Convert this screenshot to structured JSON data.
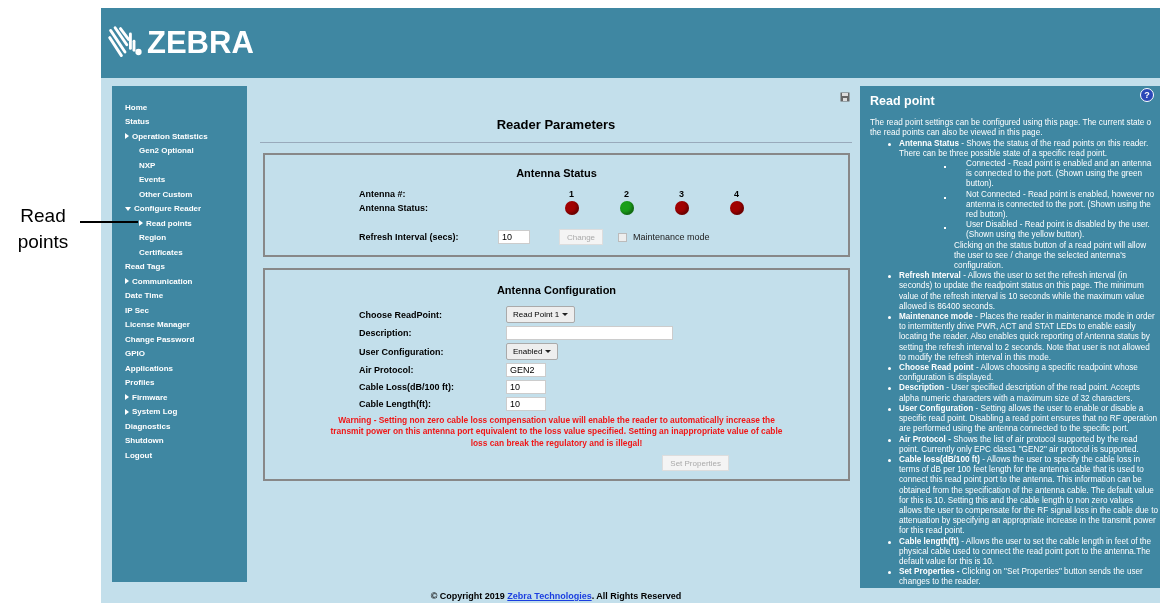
{
  "callout": {
    "text": "Read points"
  },
  "header": {
    "logo_text": "ZEBRA"
  },
  "sidebar": {
    "items": [
      {
        "label": "Home",
        "kind": "leaf"
      },
      {
        "label": "Status",
        "kind": "leaf"
      },
      {
        "label": "Operation Statistics",
        "kind": "collapsed",
        "children": [
          {
            "label": "Gen2 Optional",
            "kind": "leaf"
          },
          {
            "label": "NXP",
            "kind": "leaf"
          },
          {
            "label": "Events",
            "kind": "leaf"
          },
          {
            "label": "Other Custom",
            "kind": "leaf"
          }
        ]
      },
      {
        "label": "Configure Reader",
        "kind": "expanded",
        "children": [
          {
            "label": "Read points",
            "kind": "collapsed"
          },
          {
            "label": "Region",
            "kind": "leaf"
          },
          {
            "label": "Certificates",
            "kind": "leaf"
          }
        ]
      },
      {
        "label": "Read Tags",
        "kind": "leaf"
      },
      {
        "label": "Communication",
        "kind": "collapsed"
      },
      {
        "label": "Date Time",
        "kind": "leaf"
      },
      {
        "label": "IP Sec",
        "kind": "leaf"
      },
      {
        "label": "License Manager",
        "kind": "leaf"
      },
      {
        "label": "Change Password",
        "kind": "leaf"
      },
      {
        "label": "GPIO",
        "kind": "leaf"
      },
      {
        "label": "Applications",
        "kind": "leaf"
      },
      {
        "label": "Profiles",
        "kind": "leaf"
      },
      {
        "label": "Firmware",
        "kind": "collapsed"
      },
      {
        "label": "System Log",
        "kind": "collapsed"
      },
      {
        "label": "Diagnostics",
        "kind": "leaf"
      },
      {
        "label": "Shutdown",
        "kind": "leaf"
      },
      {
        "label": "Logout",
        "kind": "leaf"
      }
    ]
  },
  "main": {
    "title": "Reader Parameters",
    "antenna_status": {
      "title": "Antenna Status",
      "number_label": "Antenna #:",
      "status_label": "Antenna Status:",
      "antennas": [
        {
          "number": "1",
          "color": "#a10000"
        },
        {
          "number": "2",
          "color": "#1a9e1a"
        },
        {
          "number": "3",
          "color": "#a10000"
        },
        {
          "number": "4",
          "color": "#a10000"
        }
      ],
      "refresh_label": "Refresh Interval (secs):",
      "refresh_value": "10",
      "change_button": {
        "label": "Change",
        "disabled": true
      },
      "maintenance": {
        "label": "Maintenance mode",
        "checked": false
      }
    },
    "antenna_config": {
      "title": "Antenna Configuration",
      "fields": [
        {
          "kind": "dropdown",
          "label": "Choose ReadPoint:",
          "value": "Read Point 1"
        },
        {
          "kind": "wide_text",
          "label": "Description:"
        },
        {
          "kind": "dropdown",
          "label": "User Configuration:",
          "value": "Enabled"
        },
        {
          "kind": "text",
          "label": "Air Protocol:",
          "value": "GEN2"
        },
        {
          "kind": "text",
          "label": "Cable Loss(dB/100 ft):",
          "value": "10"
        },
        {
          "kind": "text",
          "label": "Cable Length(ft):",
          "value": "10"
        }
      ],
      "warning": "Warning - Setting non zero cable loss compensation value will enable the reader to automatically increase the transmit power on this antenna port equivalent to the loss value specified. Setting an inappropriate value of cable loss can break the regulatory and is illegal!",
      "set_button": {
        "label": "Set Properties",
        "disabled": true
      }
    }
  },
  "help": {
    "title": "Read point",
    "help_icon": "?",
    "intro": "The read point settings can be configured using this page. The current state o the read points can also be viewed in this page.",
    "items": [
      {
        "text": "**Antenna Status** - Shows the status of the read points on this reader. There can be three possible state of a specific read point.",
        "subitems": [
          "Connected - Read point is enabled and an antenna is connected to the port. (Shown using the green button).",
          "Not Connected - Read point is enabled, however no antenna is connected to the port. (Shown using the red button).",
          "User Disabled - Read point is disabled by the user. (Shown using the yellow button)."
        ],
        "note": "Clicking on the status button of a read point will allow the user to see / change the selected antenna's configuration."
      },
      {
        "text": "**Refresh Interval** - Allows the user to set the refresh interval (in seconds) to update the readpoint status on this page. The minimum value of the refresh interval is 10 seconds while the maximum value allowed is 86400 seconds."
      },
      {
        "text": "**Maintenance mode** - Places the reader in maintenance mode in order to intermittently drive PWR, ACT and STAT LEDs to enable easily locating the reader. Also enables quick reporting of Antenna status by setting the refresh interval to 2 seconds. Note that user is not allowed to modify the refresh interval in this mode."
      },
      {
        "text": "**Choose Read point** - Allows choosing a specific readpoint whose configuration is displayed."
      },
      {
        "text": "**Description** - User specified description of the read point. Accepts alpha numeric characters with a maximum size of 32 characters."
      },
      {
        "text": "**User Configuration** - Setting allows the user to enable or disable a specific read point. Disabling a read point ensures that no RF operation are performed using the antenna connected to the specific port."
      },
      {
        "text": "**Air Protocol -** Shows the list of air protocol supported by the read point. Currently only EPC class1 \"GEN2\" air protocol is supported."
      },
      {
        "text": "**Cable loss(dB/100 ft)** - Allows the user to specify the cable loss in terms of dB per 100 feet length for the antenna cable that is used to connect this read point port to the antenna. This information can be obtained from the specification of the antenna cable. The default value for this is 10. Setting this and the cable length to non zero values allows the user to compensate for the RF signal loss in the cable due to attenuation by specifying an appropriate increase in the transmit power for this read point."
      },
      {
        "text": "**Cable length(ft)** - Allows the user to set the cable length in feet of the physical cable used to connect the read point port to the antenna.The default value for this is 10."
      },
      {
        "text": "**Set Properties -** Clicking on \"Set Properties\" button sends the user changes to the reader."
      }
    ]
  },
  "footer": {
    "prefix": "© Copyright 2019 ",
    "link": "Zebra Technologies",
    "suffix": ". All Rights Reserved"
  }
}
